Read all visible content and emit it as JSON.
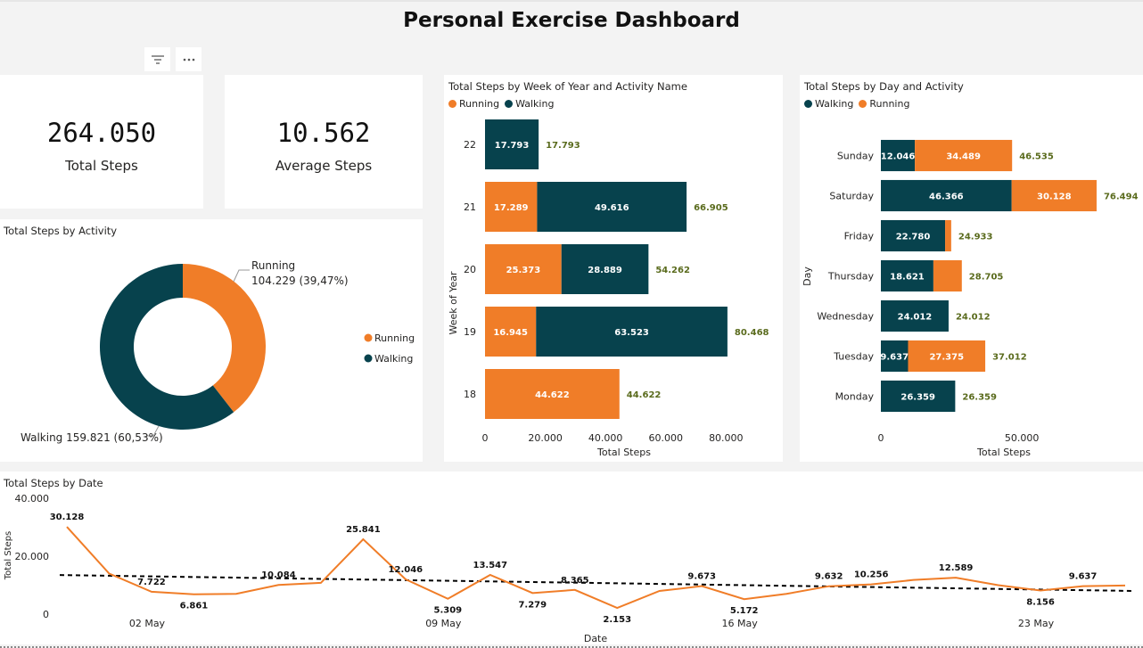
{
  "page": {
    "title": "Personal Exercise Dashboard"
  },
  "colors": {
    "running": "#f07d28",
    "walking": "#07424d",
    "total_label": "#5a6b1d",
    "trend": "#000000"
  },
  "icons": {
    "filter": "filter-icon",
    "more": "more-options-icon"
  },
  "kpis": [
    {
      "value": "264.050",
      "label": "Total Steps"
    },
    {
      "value": "10.562",
      "label": "Average Steps"
    }
  ],
  "donut": {
    "title": "Total Steps by Activity",
    "legend": [
      "Running",
      "Walking"
    ],
    "running_label_name": "Running",
    "running_label_value": "104.229 (39,47%)",
    "walking_label": "Walking 159.821 (60,53%)"
  },
  "week_chart": {
    "title": "Total Steps by Week of Year and Activity Name",
    "legend": [
      "Running",
      "Walking"
    ],
    "x_label": "Total Steps",
    "y_label": "Week of Year",
    "x_ticks": [
      "0",
      "20.000",
      "40.000",
      "60.000",
      "80.000"
    ]
  },
  "day_chart": {
    "title": "Total Steps by Day  and Activity",
    "legend": [
      "Walking",
      "Running"
    ],
    "x_label": "Total Steps",
    "y_label": "Day",
    "x_ticks": [
      "0",
      "50.000"
    ]
  },
  "date_chart": {
    "title": "Total Steps by Date",
    "x_label": "Date",
    "y_label": "Total Steps",
    "y_ticks": [
      "40.000",
      "20.000",
      "0"
    ],
    "x_ticks": [
      "02 May",
      "09 May",
      "16 May",
      "23 May"
    ]
  },
  "chart_data": [
    {
      "type": "pie",
      "title": "Total Steps by Activity",
      "categories": [
        "Running",
        "Walking"
      ],
      "values": [
        104229,
        159821
      ],
      "percent_labels": [
        "39,47%",
        "60,53%"
      ]
    },
    {
      "type": "bar",
      "orientation": "horizontal",
      "stacked": true,
      "title": "Total Steps by Week of Year and Activity Name",
      "categories": [
        "22",
        "21",
        "20",
        "19",
        "18"
      ],
      "series": [
        {
          "name": "Running",
          "values": [
            0,
            17289,
            25373,
            16945,
            44622
          ],
          "labels": [
            "",
            "17.289",
            "25.373",
            "16.945",
            "44.622"
          ]
        },
        {
          "name": "Walking",
          "values": [
            17793,
            49616,
            28889,
            63523,
            0
          ],
          "labels": [
            "17.793",
            "49.616",
            "28.889",
            "63.523",
            ""
          ]
        }
      ],
      "totals": [
        17793,
        66905,
        54262,
        80468,
        44622
      ],
      "total_labels": [
        "17.793",
        "66.905",
        "54.262",
        "80.468",
        "44.622"
      ],
      "xlim": [
        0,
        95000
      ],
      "xlabel": "Total Steps",
      "ylabel": "Week of Year"
    },
    {
      "type": "bar",
      "orientation": "horizontal",
      "stacked": true,
      "title": "Total Steps by Day  and Activity",
      "categories": [
        "Sunday",
        "Saturday",
        "Friday",
        "Thursday",
        "Wednesday",
        "Tuesday",
        "Monday"
      ],
      "series": [
        {
          "name": "Walking",
          "values": [
            12046,
            46366,
            22780,
            18621,
            24012,
            9637,
            26359
          ],
          "labels": [
            "12.046",
            "46.366",
            "22.780",
            "18.621",
            "24.012",
            "9.637",
            "26.359"
          ]
        },
        {
          "name": "Running",
          "values": [
            34489,
            30128,
            2153,
            10084,
            0,
            27375,
            0
          ],
          "labels": [
            "34.489",
            "30.128",
            "",
            "",
            "",
            "27.375",
            ""
          ]
        }
      ],
      "totals": [
        46535,
        76494,
        24933,
        28705,
        24012,
        37012,
        26359
      ],
      "total_labels": [
        "46.535",
        "76.494",
        "24.933",
        "28.705",
        "24.012",
        "37.012",
        "26.359"
      ],
      "xlim": [
        0,
        92000
      ],
      "xlabel": "Total Steps",
      "ylabel": "Day"
    },
    {
      "type": "line",
      "title": "Total Steps by Date",
      "x": [
        "2024-04-30",
        "2024-05-01",
        "2024-05-02",
        "2024-05-03",
        "2024-05-04",
        "2024-05-05",
        "2024-05-06",
        "2024-05-07",
        "2024-05-08",
        "2024-05-09",
        "2024-05-10",
        "2024-05-11",
        "2024-05-12",
        "2024-05-13",
        "2024-05-14",
        "2024-05-15",
        "2024-05-16",
        "2024-05-17",
        "2024-05-18",
        "2024-05-19",
        "2024-05-20",
        "2024-05-21",
        "2024-05-22",
        "2024-05-23",
        "2024-05-24",
        "2024-05-25"
      ],
      "series": [
        {
          "name": "Total Steps",
          "values": [
            30128,
            14000,
            7722,
            6861,
            7000,
            10084,
            10800,
            25841,
            12046,
            5309,
            13547,
            7279,
            8365,
            2153,
            8000,
            9673,
            5172,
            7000,
            9632,
            10256,
            11800,
            12589,
            10000,
            8156,
            9637,
            9900
          ]
        }
      ],
      "point_labels": [
        {
          "index": 0,
          "text": "30.128"
        },
        {
          "index": 2,
          "text": "7.722"
        },
        {
          "index": 3,
          "text": "6.861"
        },
        {
          "index": 5,
          "text": "10.084"
        },
        {
          "index": 7,
          "text": "25.841"
        },
        {
          "index": 8,
          "text": "12.046"
        },
        {
          "index": 9,
          "text": "5.309"
        },
        {
          "index": 10,
          "text": "13.547"
        },
        {
          "index": 11,
          "text": "7.279"
        },
        {
          "index": 12,
          "text": "8.365"
        },
        {
          "index": 13,
          "text": "2.153"
        },
        {
          "index": 15,
          "text": "9.673"
        },
        {
          "index": 16,
          "text": "5.172"
        },
        {
          "index": 18,
          "text": "9.632"
        },
        {
          "index": 19,
          "text": "10.256"
        },
        {
          "index": 21,
          "text": "12.589"
        },
        {
          "index": 23,
          "text": "8.156"
        },
        {
          "index": 24,
          "text": "9.637"
        }
      ],
      "trend": {
        "start": 13500,
        "end": 8000
      },
      "ylim": [
        0,
        40000
      ],
      "xlabel": "Date",
      "ylabel": "Total Steps"
    }
  ]
}
